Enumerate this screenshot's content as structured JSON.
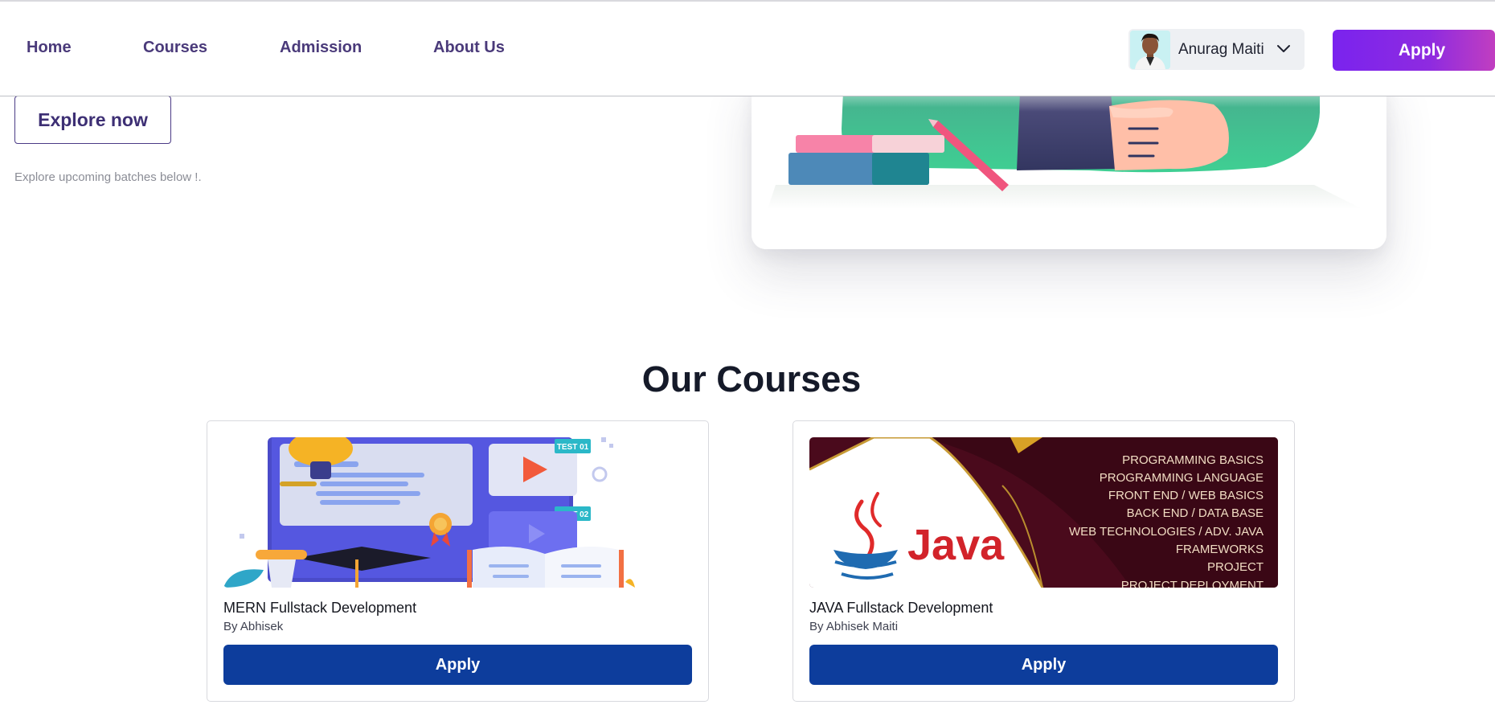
{
  "nav": {
    "items": [
      {
        "label": "Home"
      },
      {
        "label": "Courses"
      },
      {
        "label": "Admission"
      },
      {
        "label": "About Us"
      }
    ],
    "user_name": "Anurag Maiti",
    "apply_label": "Apply"
  },
  "hero": {
    "explore_label": "Explore now",
    "explore_note": "Explore upcoming batches below !."
  },
  "courses": {
    "section_title": "Our Courses",
    "items": [
      {
        "title": "MERN Fullstack Development",
        "author": "By Abhisek",
        "apply_label": "Apply",
        "image_badges": [
          "TEST 01",
          "TEST 02"
        ]
      },
      {
        "title": "JAVA Fullstack Development",
        "author": "By Abhisek Maiti",
        "apply_label": "Apply",
        "image_logo_text": "Java",
        "image_topics": [
          "PROGRAMMING BASICS",
          "PROGRAMMING LANGUAGE",
          "FRONT END / WEB BASICS",
          "BACK END / DATA BASE",
          "WEB TECHNOLOGIES / ADV. JAVA",
          "FRAMEWORKS",
          "PROJECT",
          "PROJECT DEPLOYMENT"
        ]
      }
    ]
  },
  "colors": {
    "nav_text": "#4a3a7a",
    "apply_gradient_start": "#7a23ee",
    "apply_gradient_end": "#c13ec0",
    "course_button": "#0d3d9c",
    "java_banner": "#5a0a22"
  }
}
